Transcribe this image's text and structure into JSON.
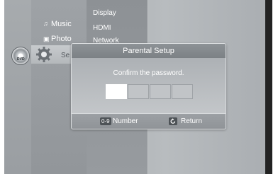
{
  "menu": {
    "music_label": "Music",
    "photo_label": "Photo",
    "settings_label": "Se",
    "disc_label": "DVD"
  },
  "submenu": {
    "items": [
      "Display",
      "HDMI",
      "Network"
    ]
  },
  "dialog": {
    "title": "Parental Setup",
    "message": "Confirm the password.",
    "password_boxes": 4,
    "active_box": 1
  },
  "footer": {
    "number_key": "0-9",
    "number_label": "Number",
    "return_label": "Return"
  },
  "colors": {
    "accent": "#ffffff",
    "panel": "#9a9ea2"
  }
}
